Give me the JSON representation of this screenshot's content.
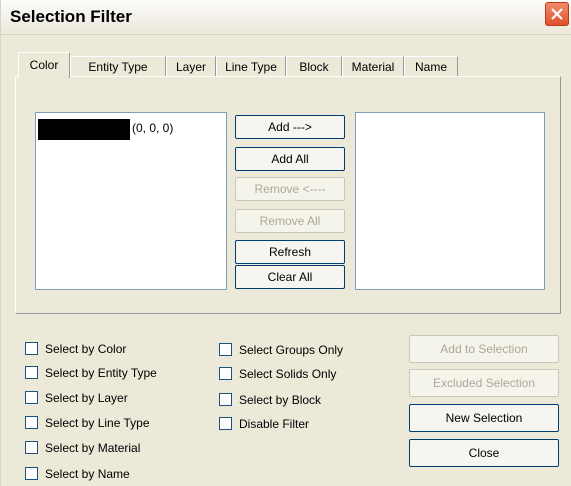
{
  "window": {
    "title": "Selection Filter"
  },
  "tabs": [
    {
      "label": "Color",
      "active": true
    },
    {
      "label": "Entity Type",
      "active": false
    },
    {
      "label": "Layer",
      "active": false
    },
    {
      "label": "Line Type",
      "active": false
    },
    {
      "label": "Block",
      "active": false
    },
    {
      "label": "Material",
      "active": false
    },
    {
      "label": "Name",
      "active": false
    }
  ],
  "color_tab": {
    "available_list": [
      {
        "swatch_color": "#000000",
        "label": "(0, 0, 0)"
      }
    ],
    "selected_list": [],
    "buttons": {
      "add": "Add --->",
      "add_all": "Add All",
      "remove": "Remove <----",
      "remove_all": "Remove All",
      "refresh": "Refresh",
      "clear_all": "Clear All"
    }
  },
  "checkboxes": {
    "col1": [
      {
        "label": "Select by Color",
        "checked": false
      },
      {
        "label": "Select by Entity Type",
        "checked": false
      },
      {
        "label": "Select by Layer",
        "checked": false
      },
      {
        "label": "Select by Line Type",
        "checked": false
      },
      {
        "label": "Select by Material",
        "checked": false
      },
      {
        "label": "Select by Name",
        "checked": false
      }
    ],
    "col2": [
      {
        "label": "Select Groups Only",
        "checked": false
      },
      {
        "label": "Select Solids Only",
        "checked": false
      },
      {
        "label": "Select by Block",
        "checked": false
      },
      {
        "label": "Disable Filter",
        "checked": false
      }
    ]
  },
  "actions": {
    "add_to_selection": "Add to Selection",
    "excluded_selection": "Excluded Selection",
    "new_selection": "New Selection",
    "close": "Close"
  },
  "colors": {
    "dialog_bg": "#ece9d8",
    "close_button": "#e0502c",
    "disabled_text": "#aca899"
  }
}
